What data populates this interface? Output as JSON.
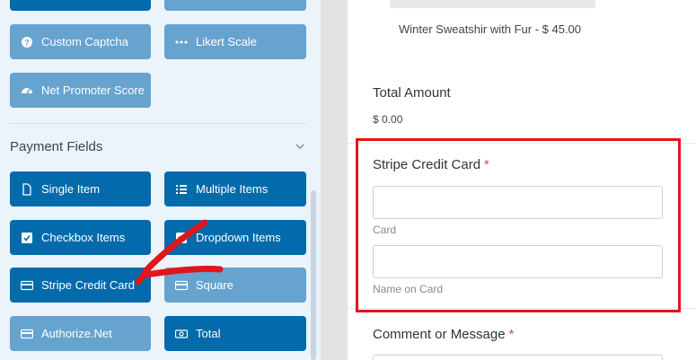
{
  "left_panel": {
    "top_buttons": [
      {
        "label": "",
        "style": "dark"
      },
      {
        "label": "",
        "style": "light"
      }
    ],
    "fancy_buttons": [
      {
        "label": "Custom Captcha",
        "icon": "question-circle-icon",
        "style": "light"
      },
      {
        "label": "Likert Scale",
        "icon": "ellipsis-icon",
        "style": "light"
      },
      {
        "label": "Net Promoter Score",
        "icon": "gauge-icon",
        "style": "light"
      }
    ],
    "section_title": "Payment Fields",
    "payment_buttons": [
      {
        "label": "Single Item",
        "icon": "file-icon",
        "style": "dark"
      },
      {
        "label": "Multiple Items",
        "icon": "list-icon",
        "style": "dark"
      },
      {
        "label": "Checkbox Items",
        "icon": "checkbox-icon",
        "style": "dark"
      },
      {
        "label": "Dropdown Items",
        "icon": "dropdown-icon",
        "style": "dark"
      },
      {
        "label": "Stripe Credit Card",
        "icon": "credit-card-icon",
        "style": "dark"
      },
      {
        "label": "Square",
        "icon": "credit-card-icon",
        "style": "light"
      },
      {
        "label": "Authorize.Net",
        "icon": "credit-card-icon",
        "style": "light"
      },
      {
        "label": "Total",
        "icon": "money-icon",
        "style": "dark"
      }
    ]
  },
  "preview": {
    "product_label": "Winter Sweatshir with Fur - $ 45.00",
    "total_title": "Total Amount",
    "total_value": "$ 0.00",
    "stripe_field": {
      "title": "Stripe Credit Card",
      "required_mark": "*",
      "card_sublabel": "Card",
      "name_sublabel": "Name on Card"
    },
    "comment_field": {
      "title": "Comment or Message",
      "required_mark": "*"
    }
  },
  "colors": {
    "accent_dark": "#036aab",
    "accent_light": "#66a3cf",
    "highlight_red": "#e1161b",
    "required_red": "#e34a4a"
  }
}
